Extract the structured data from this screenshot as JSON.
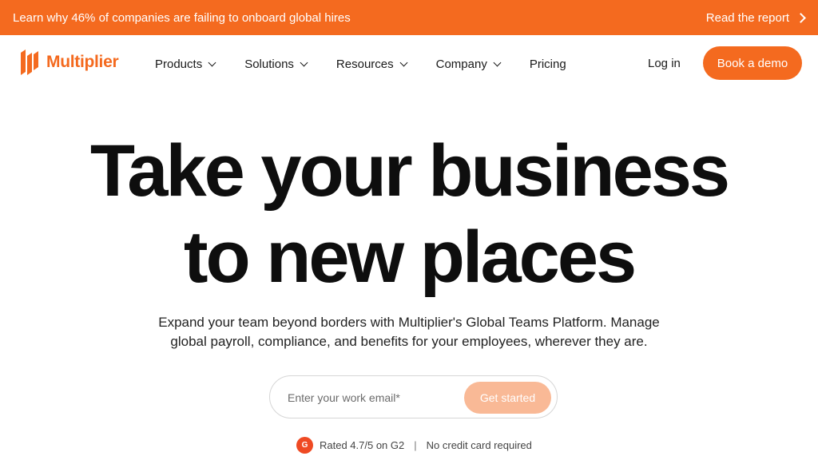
{
  "announcement": {
    "text": "Learn why 46% of companies are failing to onboard global hires",
    "link_label": "Read the report"
  },
  "brand": {
    "name": "Multiplier",
    "color": "#f46a1f"
  },
  "nav": {
    "items": [
      {
        "label": "Products",
        "has_dropdown": true
      },
      {
        "label": "Solutions",
        "has_dropdown": true
      },
      {
        "label": "Resources",
        "has_dropdown": true
      },
      {
        "label": "Company",
        "has_dropdown": true
      },
      {
        "label": "Pricing",
        "has_dropdown": false
      }
    ],
    "login_label": "Log in",
    "demo_label": "Book a demo"
  },
  "hero": {
    "title_line1": "Take your business",
    "title_line2": "to new places",
    "subtitle_line1": "Expand your team beyond borders with Multiplier's Global Teams Platform. Manage",
    "subtitle_line2": "global payroll, compliance, and benefits for your employees, wherever they are."
  },
  "signup": {
    "email_placeholder": "Enter your work email*",
    "email_value": "",
    "cta_label": "Get started"
  },
  "trust": {
    "badge_text": "G",
    "rating_text": "Rated 4.7/5 on G2",
    "separator": "|",
    "note": "No credit card required"
  },
  "colors": {
    "accent": "#f46a1f",
    "cta_disabled": "#f9b996"
  }
}
